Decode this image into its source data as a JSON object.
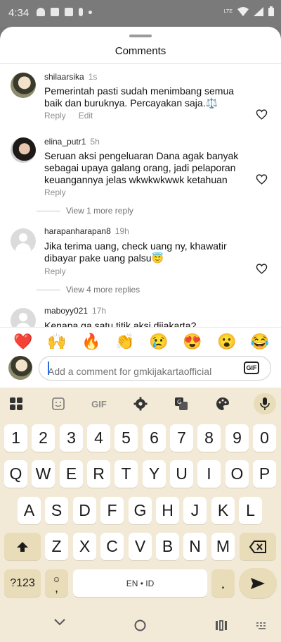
{
  "status_bar": {
    "time": "4:34",
    "network": "LTE"
  },
  "sheet": {
    "title": "Comments"
  },
  "comments": [
    {
      "username": "shilaarsika",
      "time": "1s",
      "text": "Pemerintah pasti sudah menimbang semua baik dan buruknya. Percayakan saja.⚖️",
      "reply": "Reply",
      "edit": "Edit"
    },
    {
      "username": "elina_putr1",
      "time": "5h",
      "text": "Seruan aksi pengeluaran Dana agak banyak sebagai upaya galang orang, jadi pelaporan keuangannya jelas wkwkwkwwk ketahuan",
      "reply": "Reply",
      "view_more": "View 1 more reply"
    },
    {
      "username": "harapanharapan8",
      "time": "19h",
      "text": "Jika terima uang, check uang ny, khawatir dibayar pake uang palsu😇",
      "reply": "Reply",
      "view_more": "View 4 more replies"
    },
    {
      "username": "maboyy021",
      "time": "17h",
      "text": "Kenapa ga satu titik aksi dijakarta?"
    }
  ],
  "emoji_bar": [
    "❤️",
    "🙌",
    "🔥",
    "👏",
    "😢",
    "😍",
    "😮",
    "😂"
  ],
  "composer": {
    "placeholder": "Add a comment for gmkijakartaofficial",
    "gif_label": "GIF"
  },
  "keyboard": {
    "toolbar_gif": "GIF",
    "row_numbers": [
      "1",
      "2",
      "3",
      "4",
      "5",
      "6",
      "7",
      "8",
      "9",
      "0"
    ],
    "row_1": [
      "Q",
      "W",
      "E",
      "R",
      "T",
      "Y",
      "U",
      "I",
      "O",
      "P"
    ],
    "row_2": [
      "A",
      "S",
      "D",
      "F",
      "G",
      "H",
      "J",
      "K",
      "L"
    ],
    "row_3": [
      "Z",
      "X",
      "C",
      "V",
      "B",
      "N",
      "M"
    ],
    "symbols_key": "?123",
    "comma_key": ",",
    "space_label": "EN • ID",
    "period_key": "."
  }
}
